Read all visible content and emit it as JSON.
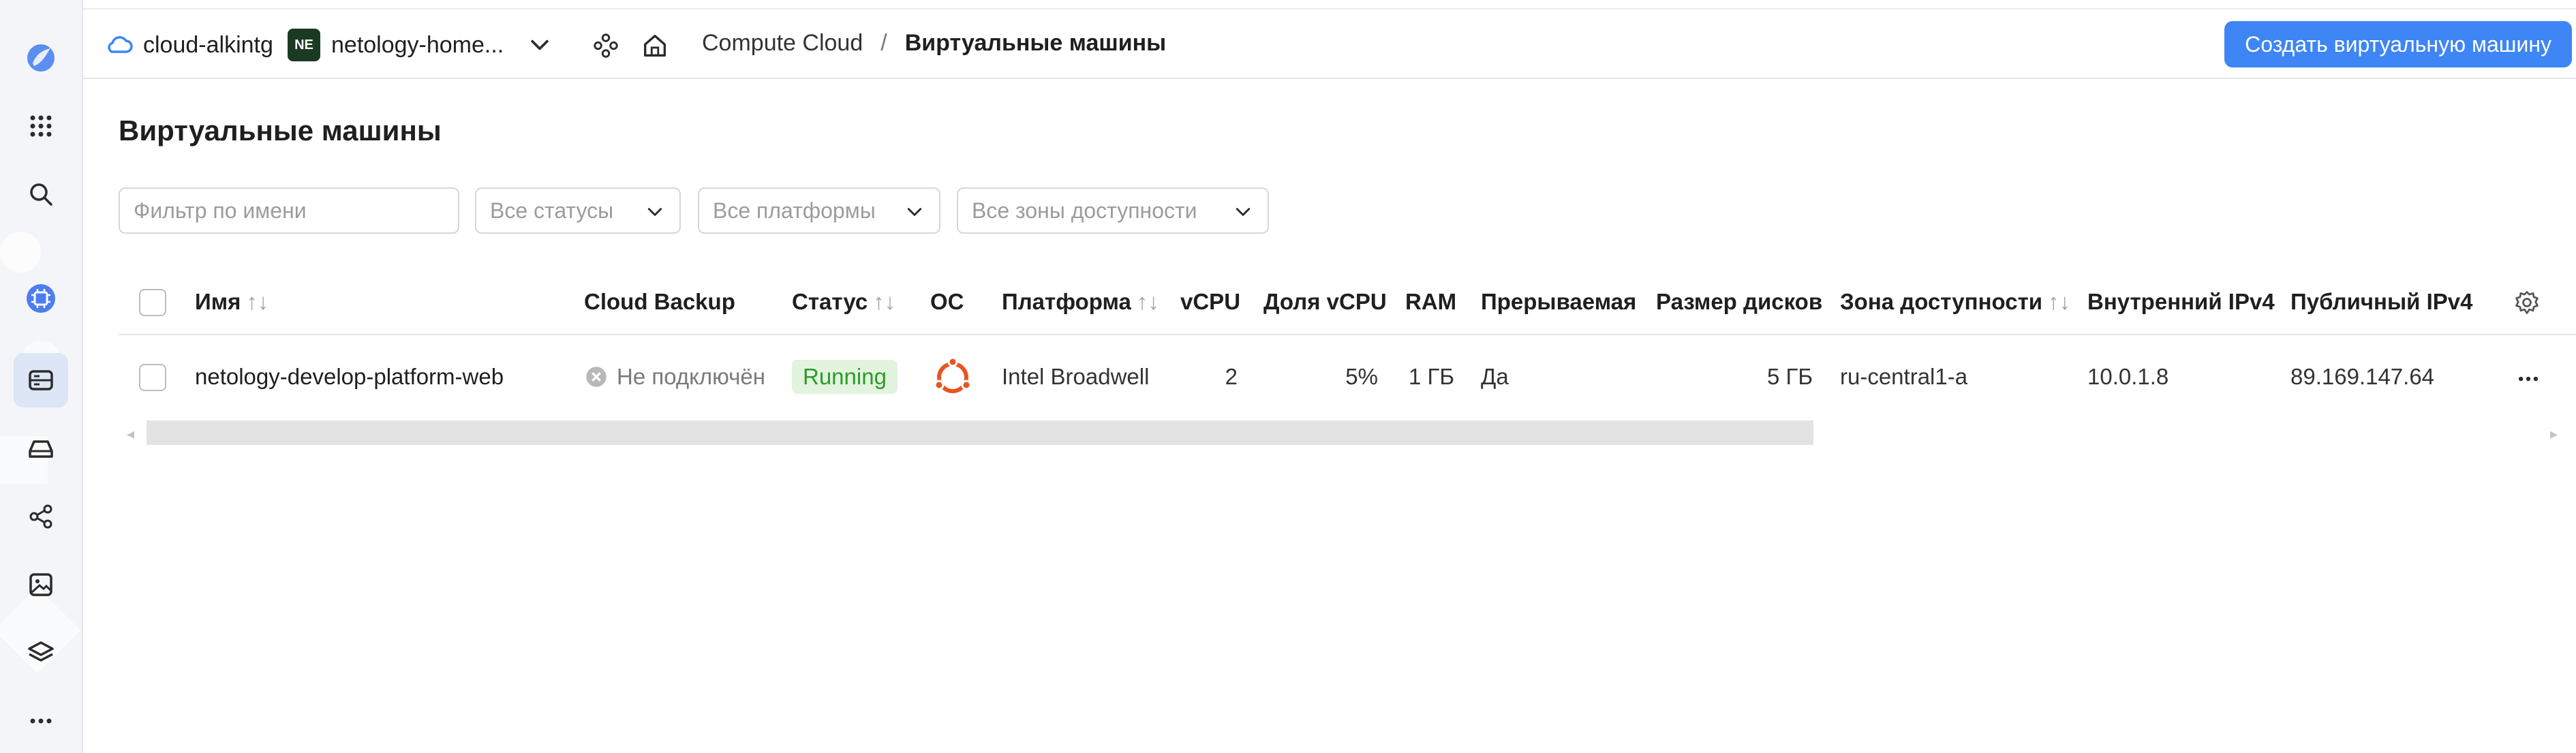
{
  "topbar": {
    "cloud_name": "cloud-alkintg",
    "folder_badge": "NE",
    "folder_name": "netology-home...",
    "breadcrumb_root": "Compute Cloud",
    "breadcrumb_sep": "/",
    "breadcrumb_current": "Виртуальные машины",
    "create_button": "Создать виртуальную машину"
  },
  "page": {
    "title": "Виртуальные машины"
  },
  "filters": {
    "name_placeholder": "Фильтр по имени",
    "status": "Все статусы",
    "platform": "Все платформы",
    "zone": "Все зоны доступности"
  },
  "table": {
    "headers": {
      "name": "Имя",
      "backup": "Cloud Backup",
      "status": "Статус",
      "os": "ОС",
      "platform": "Платформа",
      "vcpu": "vCPU",
      "vcpu_share": "Доля vCPU",
      "ram": "RAM",
      "preemptible": "Прерываемая",
      "disk_size": "Размер дисков",
      "zone": "Зона доступности",
      "internal_ip": "Внутренний IPv4",
      "public_ip": "Публичный IPv4"
    },
    "sort_glyph": "↑↓",
    "rows": [
      {
        "name": "netology-develop-platform-web",
        "backup": "Не подключён",
        "status": "Running",
        "os_icon": "ubuntu-icon",
        "platform": "Intel Broadwell",
        "vcpu": "2",
        "vcpu_share": "5%",
        "ram": "1 ГБ",
        "preemptible": "Да",
        "disk_size": "5 ГБ",
        "zone": "ru-central1-a",
        "internal_ip": "10.0.1.8",
        "public_ip": "89.169.147.64"
      }
    ]
  },
  "colors": {
    "accent": "#3e85f5",
    "status_running_bg": "#e2f3de",
    "status_running_text": "#2f9a2b",
    "ubuntu": "#e95420"
  }
}
